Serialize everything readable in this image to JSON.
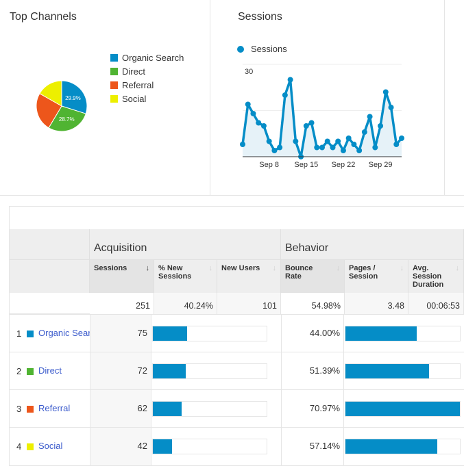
{
  "top_channels": {
    "title": "Top Channels",
    "legend": [
      {
        "label": "Organic Search",
        "color": "#058dc7"
      },
      {
        "label": "Direct",
        "color": "#50b432"
      },
      {
        "label": "Referral",
        "color": "#ed561b"
      },
      {
        "label": "Social",
        "color": "#edef00"
      }
    ],
    "chart_data": {
      "type": "pie",
      "categories": [
        "Organic Search",
        "Direct",
        "Referral",
        "Social"
      ],
      "values": [
        75,
        72,
        62,
        42
      ],
      "data_labels": [
        "29.9%",
        "28.7%",
        "",
        ""
      ]
    }
  },
  "sessions_chart": {
    "title": "Sessions",
    "legend": "Sessions",
    "color": "#058dc7",
    "chart_data": {
      "type": "line",
      "x_ticks": [
        "Sep 8",
        "Sep 15",
        "Sep 22",
        "Sep 29"
      ],
      "y_ticks": [
        "30",
        "15"
      ],
      "ylim": [
        0,
        30
      ],
      "x_start": "Sep 3",
      "series": [
        {
          "name": "Sessions",
          "values": [
            4,
            17,
            14,
            11,
            10,
            5,
            2,
            3,
            20,
            25,
            5,
            0,
            10,
            11,
            3,
            3,
            5,
            3,
            5,
            2,
            6,
            4,
            2,
            8,
            13,
            3,
            10,
            21,
            16,
            4,
            6
          ]
        }
      ]
    }
  },
  "table": {
    "groups": [
      "Acquisition",
      "Behavior"
    ],
    "columns": [
      {
        "label": "Sessions",
        "sort": "↓"
      },
      {
        "label": "% New Sessions",
        "sort": "↓"
      },
      {
        "label": "New Users",
        "sort": "↓"
      },
      {
        "label": "Bounce Rate",
        "sort": "↓"
      },
      {
        "label": "Pages / Session",
        "sort": "↓"
      },
      {
        "label": "Avg. Session Duration",
        "sort": "↓"
      }
    ],
    "totals": {
      "sessions": "251",
      "pct_new": "40.24%",
      "new_users": "101",
      "bounce": "54.98%",
      "pages": "3.48",
      "duration": "00:06:53"
    },
    "rows": [
      {
        "rank": "1",
        "name": "Organic Search",
        "color": "#058dc7",
        "sessions": "75",
        "new_sessions_bar": 0.3,
        "bounce": "44.00%",
        "pages_bar": 0.62
      },
      {
        "rank": "2",
        "name": "Direct",
        "color": "#50b432",
        "sessions": "72",
        "new_sessions_bar": 0.29,
        "bounce": "51.39%",
        "pages_bar": 0.73
      },
      {
        "rank": "3",
        "name": "Referral",
        "color": "#ed561b",
        "sessions": "62",
        "new_sessions_bar": 0.25,
        "bounce": "70.97%",
        "pages_bar": 1.0
      },
      {
        "rank": "4",
        "name": "Social",
        "color": "#edef00",
        "sessions": "42",
        "new_sessions_bar": 0.17,
        "bounce": "57.14%",
        "pages_bar": 0.8
      }
    ],
    "bar_color": "#058dc7"
  }
}
